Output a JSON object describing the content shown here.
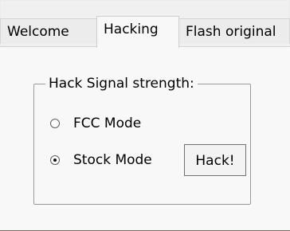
{
  "tabs": [
    {
      "label": "Welcome"
    },
    {
      "label": "Hacking"
    },
    {
      "label": "Flash original"
    }
  ],
  "group": {
    "title": "Hack Signal strength:",
    "options": [
      {
        "label": "FCC Mode"
      },
      {
        "label": "Stock Mode"
      }
    ],
    "selected": "Stock Mode",
    "button_label": "Hack!"
  }
}
